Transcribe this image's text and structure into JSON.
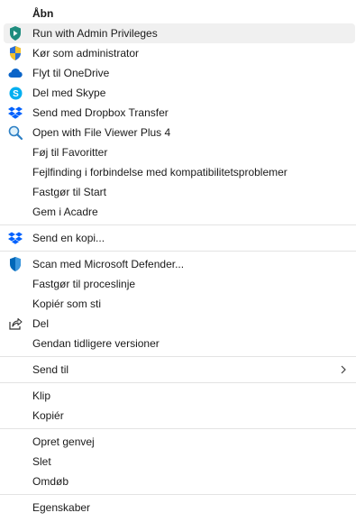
{
  "menu": {
    "open": "Åbn",
    "run_admin": "Run with Admin Privileges",
    "run_as_admin": "Kør som administrator",
    "onedrive": "Flyt til OneDrive",
    "skype": "Del med Skype",
    "dropbox_transfer": "Send med Dropbox Transfer",
    "file_viewer": "Open with File Viewer Plus 4",
    "favorites": "Føj til Favoritter",
    "compat": "Fejlfinding i forbindelse med kompatibilitetsproblemer",
    "pin_start": "Fastgør til Start",
    "acadre": "Gem i Acadre",
    "send_copy": "Send en kopi...",
    "defender": "Scan med Microsoft Defender...",
    "pin_taskbar": "Fastgør til proceslinje",
    "copy_path": "Kopiér som sti",
    "share": "Del",
    "restore": "Gendan tidligere versioner",
    "send_to": "Send til",
    "cut": "Klip",
    "copy": "Kopiér",
    "create_shortcut": "Opret genvej",
    "delete": "Slet",
    "rename": "Omdøb",
    "properties": "Egenskaber"
  },
  "icons": {
    "run_admin": "shield-run-icon",
    "run_as_admin": "uac-shield-icon",
    "onedrive": "onedrive-cloud-icon",
    "skype": "skype-icon",
    "dropbox": "dropbox-icon",
    "file_viewer": "magnifier-icon",
    "defender": "defender-shield-icon",
    "share": "share-icon",
    "send_to": "chevron-right-icon"
  },
  "colors": {
    "hover_bg": "#f0f0f0",
    "separator": "#e3e3e3",
    "dropbox_blue": "#0061fe",
    "onedrive_blue": "#0a64c8",
    "skype_blue": "#00aff0",
    "defender_blue": "#0067b8"
  }
}
